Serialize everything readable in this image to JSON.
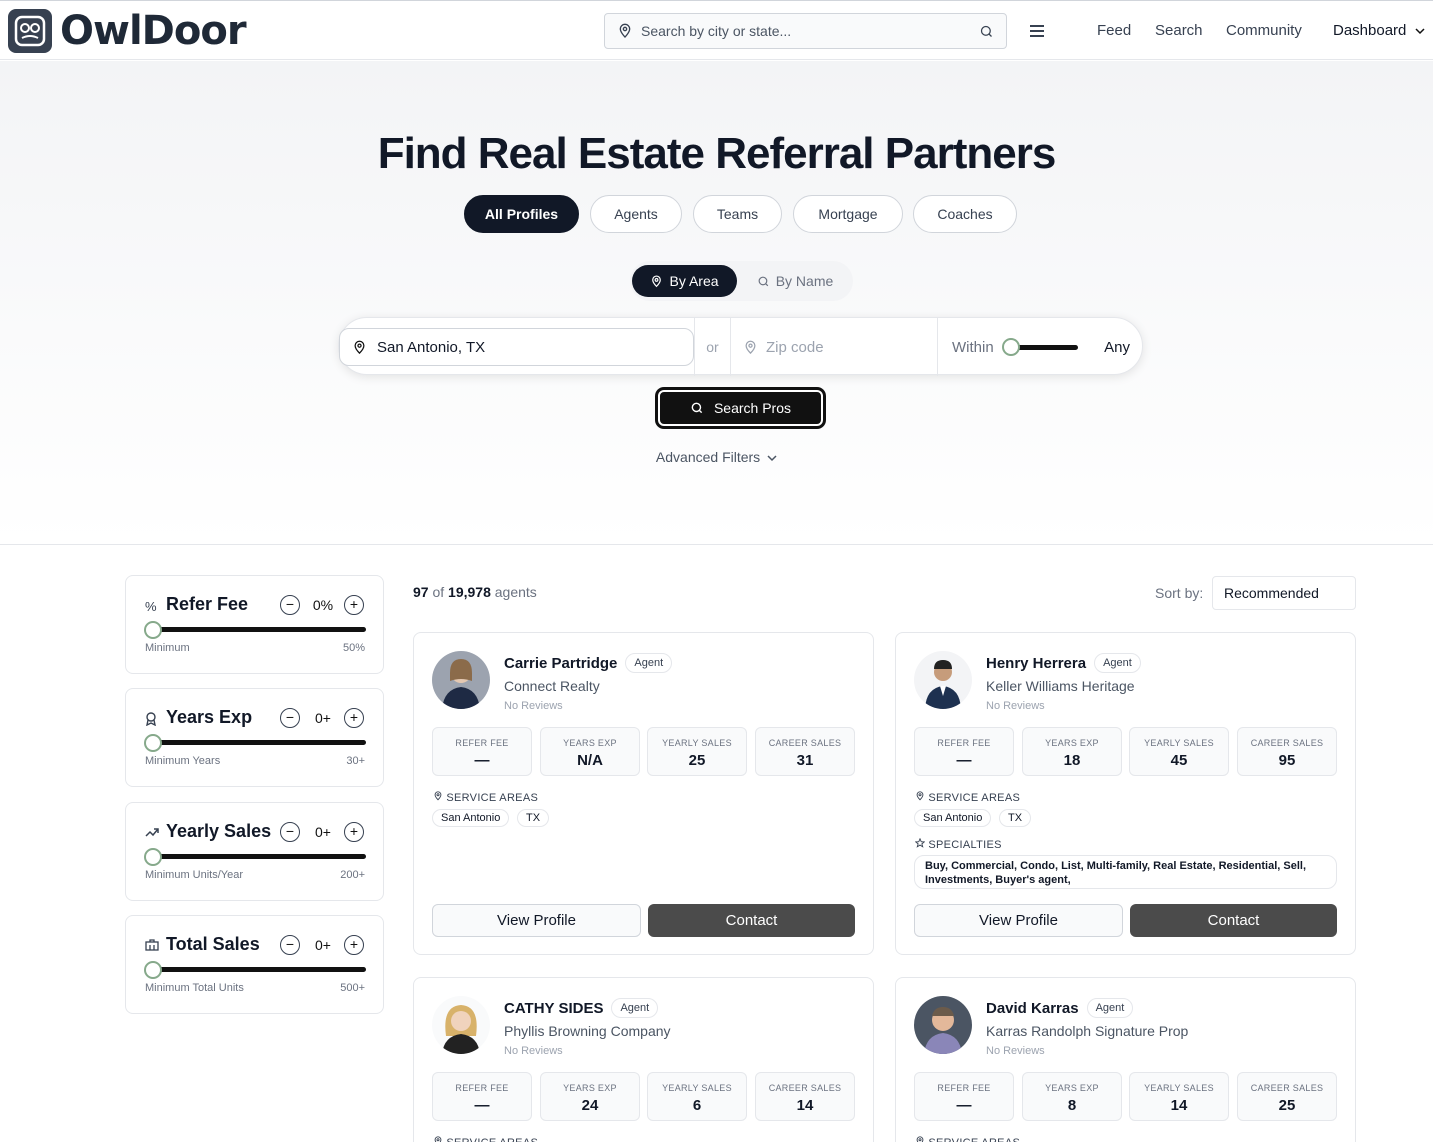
{
  "header": {
    "logo_text": "OwlDoor",
    "search_placeholder": "Search by city or state...",
    "nav": {
      "feed": "Feed",
      "search": "Search",
      "community": "Community",
      "dashboard": "Dashboard"
    }
  },
  "hero": {
    "title": "Find Real Estate Referral Partners",
    "tabs": [
      "All Profiles",
      "Agents",
      "Teams",
      "Mortgage",
      "Coaches"
    ],
    "active_tab": "All Profiles",
    "modes": {
      "area": "By Area",
      "name": "By Name"
    },
    "city_value": "San Antonio, TX",
    "or_label": "or",
    "zip_placeholder": "Zip code",
    "within_label": "Within",
    "within_value": "Any",
    "search_button": "Search Pros",
    "advanced_filters": "Advanced Filters"
  },
  "filters": [
    {
      "title": "Refer Fee",
      "value": "0%",
      "min_label": "Minimum",
      "max_label": "50%",
      "icon": "percent-icon"
    },
    {
      "title": "Years Exp",
      "value": "0+",
      "min_label": "Minimum Years",
      "max_label": "30+",
      "icon": "award-icon"
    },
    {
      "title": "Yearly Sales",
      "value": "0+",
      "min_label": "Minimum Units/Year",
      "max_label": "200+",
      "icon": "trending-up-icon"
    },
    {
      "title": "Total Sales",
      "value": "0+",
      "min_label": "Minimum Total Units",
      "max_label": "500+",
      "icon": "building-icon"
    }
  ],
  "results": {
    "shown": "97",
    "of": "of",
    "total": "19,978",
    "unit": "agents",
    "sort_label": "Sort by:",
    "sort_value": "Recommended"
  },
  "stat_labels": {
    "refer_fee": "REFER FEE",
    "years_exp": "YEARS EXP",
    "yearly_sales": "YEARLY SALES",
    "career_sales": "CAREER SALES"
  },
  "section_labels": {
    "service_areas": "SERVICE AREAS",
    "specialties": "SPECIALTIES"
  },
  "buttons": {
    "view_profile": "View Profile",
    "contact": "Contact"
  },
  "agents": [
    {
      "name": "Carrie Partridge",
      "badge": "Agent",
      "company": "Connect Realty",
      "reviews": "No Reviews",
      "refer_fee": "—",
      "years_exp": "N/A",
      "yearly_sales": "25",
      "career_sales": "31",
      "areas": [
        "San Antonio",
        "TX"
      ],
      "specialties": ""
    },
    {
      "name": "Henry Herrera",
      "badge": "Agent",
      "company": "Keller Williams Heritage",
      "reviews": "No Reviews",
      "refer_fee": "—",
      "years_exp": "18",
      "yearly_sales": "45",
      "career_sales": "95",
      "areas": [
        "San Antonio",
        "TX"
      ],
      "specialties": "Buy, Commercial, Condo, List, Multi-family, Real Estate, Residential, Sell, Investments, Buyer's agent,"
    },
    {
      "name": "CATHY SIDES",
      "badge": "Agent",
      "company": "Phyllis Browning Company",
      "reviews": "No Reviews",
      "refer_fee": "—",
      "years_exp": "24",
      "yearly_sales": "6",
      "career_sales": "14",
      "areas": [],
      "specialties": ""
    },
    {
      "name": "David Karras",
      "badge": "Agent",
      "company": "Karras Randolph Signature Prop",
      "reviews": "No Reviews",
      "refer_fee": "—",
      "years_exp": "8",
      "yearly_sales": "14",
      "career_sales": "25",
      "areas": [],
      "specialties": ""
    }
  ]
}
